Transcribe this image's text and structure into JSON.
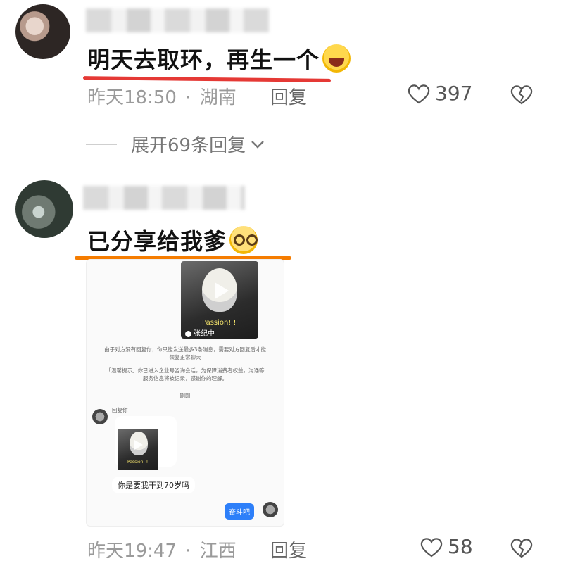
{
  "comments": [
    {
      "text": "明天去取环，再生一个",
      "time": "昨天18:50",
      "location": "湖南",
      "reply_label": "回复",
      "likes": "397",
      "underline_color": "#e53935",
      "emoji": "laughing-tears-emoji"
    },
    {
      "text": "已分享给我爹",
      "time": "昨天19:47",
      "location": "江西",
      "reply_label": "回复",
      "likes": "58",
      "underline_color": "#f57c00",
      "emoji": "nerd-emoji"
    }
  ],
  "expand_replies": "展开69条回复",
  "separator": "·",
  "screenshot": {
    "video_caption": "Passion! !",
    "video_channel": "张纪中",
    "notice1": "由于对方没有回复你，你只能发送最多3条消息，需要对方回复后才能恢复正常聊天",
    "notice2": "「温馨提示」你已进入企业号咨询会话，为保障消费者权益，沟通等服务信息将被记录，感谢你的理解。",
    "divider": "刚刚",
    "reply_from": "回复你",
    "inner_video_caption": "Passion! !",
    "message1": "你是要我干到70岁吗",
    "message2": "奋斗吧"
  }
}
